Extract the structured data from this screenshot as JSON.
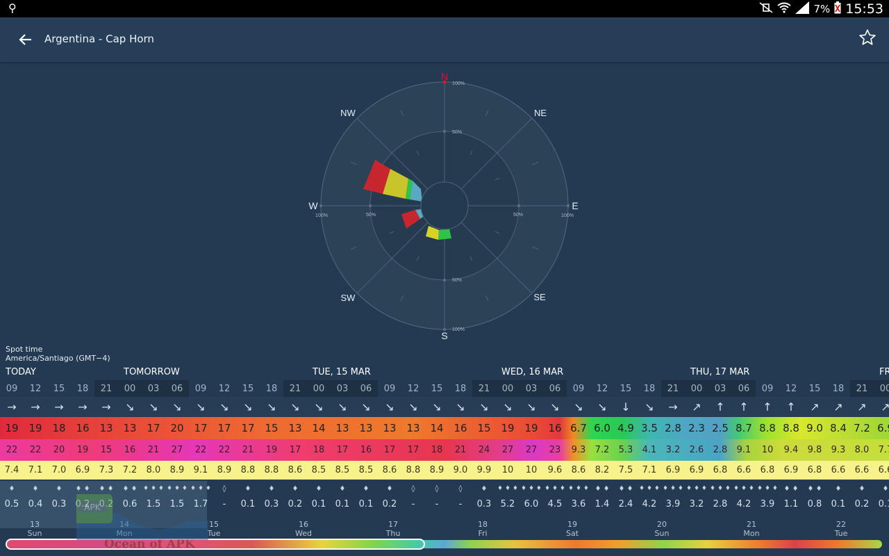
{
  "status_bar": {
    "battery": "7%",
    "time": "15:53"
  },
  "app_bar": {
    "title": "Argentina - Cap Horn"
  },
  "compass": {
    "cardinals": [
      "N",
      "NE",
      "E",
      "SE",
      "S",
      "SW",
      "W",
      "NW"
    ],
    "ring_labels": [
      "100%",
      "50%"
    ],
    "colors": {
      "north": "#e3102a",
      "grid": "#4c6277",
      "face": "#2e4459"
    }
  },
  "spot_time": {
    "label": "Spot time",
    "zone": "America/Santiago (GMT−4)"
  },
  "days": [
    "TODAY",
    "TOMORROW",
    "TUE,  15 MAR",
    "WED,  16 MAR",
    "THU,  17 MAR",
    "FR"
  ],
  "hours": [
    "09",
    "12",
    "15",
    "18",
    "21",
    "00",
    "03",
    "06",
    "09",
    "12",
    "15",
    "18",
    "21",
    "00",
    "03",
    "06",
    "09",
    "12",
    "15",
    "18",
    "21",
    "00",
    "03",
    "06",
    "09",
    "12",
    "15",
    "18",
    "21",
    "00",
    "03",
    "06",
    "09",
    "12",
    "15",
    "18",
    "21",
    "00"
  ],
  "directions": [
    "→",
    "→",
    "→",
    "→",
    "→",
    "↘",
    "↘",
    "↘",
    "↘",
    "↘",
    "↘",
    "↘",
    "↘",
    "↘",
    "↘",
    "↘",
    "↘",
    "↘",
    "↘",
    "↘",
    "↘",
    "↘",
    "↘",
    "↘",
    "↘",
    "↘",
    "↓",
    "↘",
    "→",
    "↗",
    "↑",
    "↑",
    "↑",
    "↑",
    "↗",
    "↗",
    "↗",
    "↗"
  ],
  "wind_speed": [
    "19",
    "19",
    "18",
    "16",
    "13",
    "13",
    "17",
    "20",
    "17",
    "17",
    "17",
    "15",
    "13",
    "14",
    "13",
    "13",
    "13",
    "13",
    "14",
    "16",
    "15",
    "19",
    "19",
    "16",
    "6.7",
    "6.0",
    "4.9",
    "3.5",
    "2.8",
    "2.3",
    "2.5",
    "8.7",
    "8.8",
    "8.8",
    "9.0",
    "8.4",
    "7.2",
    "6.9"
  ],
  "wind_gust": [
    "22",
    "22",
    "20",
    "19",
    "15",
    "16",
    "21",
    "27",
    "22",
    "22",
    "21",
    "19",
    "17",
    "18",
    "17",
    "16",
    "17",
    "17",
    "18",
    "21",
    "24",
    "27",
    "27",
    "23",
    "9.3",
    "7.2",
    "5.3",
    "4.1",
    "3.2",
    "2.6",
    "2.8",
    "9.1",
    "10",
    "9.4",
    "9.8",
    "9.3",
    "8.0",
    "7.7"
  ],
  "temperature": [
    "7.4",
    "7.1",
    "7.0",
    "6.9",
    "7.3",
    "7.2",
    "8.0",
    "8.9",
    "9.1",
    "8.9",
    "8.8",
    "8.8",
    "8.6",
    "8.5",
    "8.5",
    "8.5",
    "8.6",
    "8.8",
    "8.9",
    "9.0",
    "9.9",
    "10",
    "10",
    "9.6",
    "8.6",
    "8.2",
    "7.5",
    "7.1",
    "6.9",
    "6.9",
    "6.8",
    "6.6",
    "6.8",
    "6.9",
    "6.8",
    "6.6",
    "6.6",
    "6.6"
  ],
  "precip_drops": [
    1,
    1,
    1,
    2,
    2,
    2,
    3,
    3,
    3,
    1,
    1,
    1,
    1,
    1,
    1,
    1,
    1,
    1,
    1,
    1,
    1,
    3,
    3,
    3,
    3,
    2,
    2,
    3,
    3,
    3,
    3,
    3,
    3,
    2,
    2,
    1,
    1,
    1
  ],
  "precipitation": [
    "0.5",
    "0.4",
    "0.3",
    "0.2",
    "0.2",
    "0.6",
    "1.5",
    "1.5",
    "1.7",
    "-",
    "0.1",
    "0.3",
    "0.2",
    "0.1",
    "0.1",
    "0.1",
    "0.2",
    "-",
    "-",
    "-",
    "0.3",
    "5.2",
    "6.0",
    "4.5",
    "3.6",
    "1.4",
    "2.4",
    "4.2",
    "3.9",
    "3.2",
    "2.8",
    "4.2",
    "3.9",
    "1.1",
    "0.8",
    "0.1",
    "0.2",
    "0.1"
  ],
  "timeline": [
    {
      "num": "13",
      "day": "Sun"
    },
    {
      "num": "14",
      "day": "Mon"
    },
    {
      "num": "15",
      "day": "Tue"
    },
    {
      "num": "16",
      "day": "Wed"
    },
    {
      "num": "17",
      "day": "Thu"
    },
    {
      "num": "18",
      "day": "Fri"
    },
    {
      "num": "19",
      "day": "Sat"
    },
    {
      "num": "20",
      "day": "Sun"
    },
    {
      "num": "21",
      "day": "Mon"
    },
    {
      "num": "22",
      "day": "Tue"
    }
  ],
  "watermark": {
    "text": "Ocean of APK",
    "badge": "APK"
  }
}
